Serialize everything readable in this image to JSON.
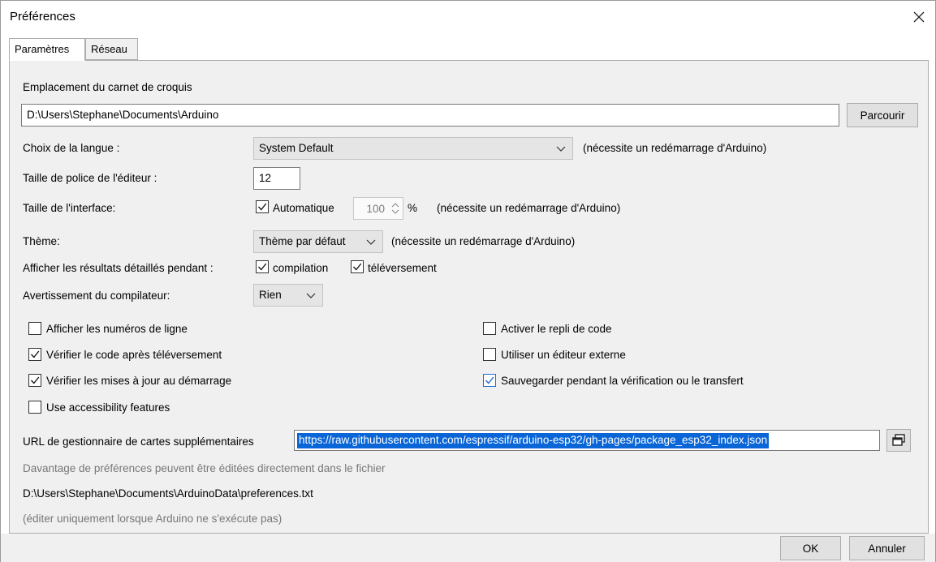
{
  "window": {
    "title": "Préférences"
  },
  "tabs": [
    {
      "label": "Paramètres",
      "active": true
    },
    {
      "label": "Réseau",
      "active": false
    }
  ],
  "sketchbook": {
    "label": "Emplacement du carnet de croquis",
    "path": "D:\\Users\\Stephane\\Documents\\Arduino",
    "browse_label": "Parcourir"
  },
  "language": {
    "label": "Choix de la langue :",
    "value": "System Default",
    "note": "(nécessite un redémarrage d'Arduino)"
  },
  "font_size": {
    "label": "Taille de police de l'éditeur :",
    "value": "12"
  },
  "interface_size": {
    "label": "Taille de l'interface:",
    "auto_label": "Automatique",
    "auto_checked": true,
    "value": "100",
    "unit": "%",
    "note": "(nécessite un redémarrage d'Arduino)"
  },
  "theme": {
    "label": "Thème:",
    "value": "Thème par défaut",
    "note": "(nécessite un redémarrage d'Arduino)"
  },
  "verbose": {
    "label": "Afficher les résultats détaillés pendant :",
    "compile_label": "compilation",
    "compile_checked": true,
    "upload_label": "téléversement",
    "upload_checked": true
  },
  "warnings": {
    "label": "Avertissement du compilateur:",
    "value": "Rien"
  },
  "options_left": [
    {
      "label": "Afficher les numéros de ligne",
      "checked": false
    },
    {
      "label": "Vérifier le code après téléversement",
      "checked": true
    },
    {
      "label": "Vérifier les mises à jour au démarrage",
      "checked": true
    },
    {
      "label": "Use accessibility features",
      "checked": false
    }
  ],
  "options_right": [
    {
      "label": "Activer le repli de code",
      "checked": false
    },
    {
      "label": "Utiliser un éditeur externe",
      "checked": false
    },
    {
      "label": "Sauvegarder pendant la vérification ou le transfert",
      "checked": true
    }
  ],
  "boards_url": {
    "label": "URL de gestionnaire de cartes supplémentaires",
    "value": "https://raw.githubusercontent.com/espressif/arduino-esp32/gh-pages/package_esp32_index.json"
  },
  "more_prefs": {
    "hint": "Davantage de préférences peuvent être éditées directement dans le fichier",
    "path": "D:\\Users\\Stephane\\Documents\\ArduinoData\\preferences.txt",
    "note": "(éditer uniquement lorsque Arduino ne s'exécute pas)"
  },
  "footer": {
    "ok_label": "OK",
    "cancel_label": "Annuler"
  },
  "colors": {
    "accent": "#0a66d6",
    "panel": "#f0f0f0",
    "check_blue": "#1e6fcf"
  },
  "icons": {
    "close": "close-icon",
    "dropdown": "chevron-down-icon",
    "spin": "spin-arrows-icon",
    "expand": "window-expand-icon"
  }
}
